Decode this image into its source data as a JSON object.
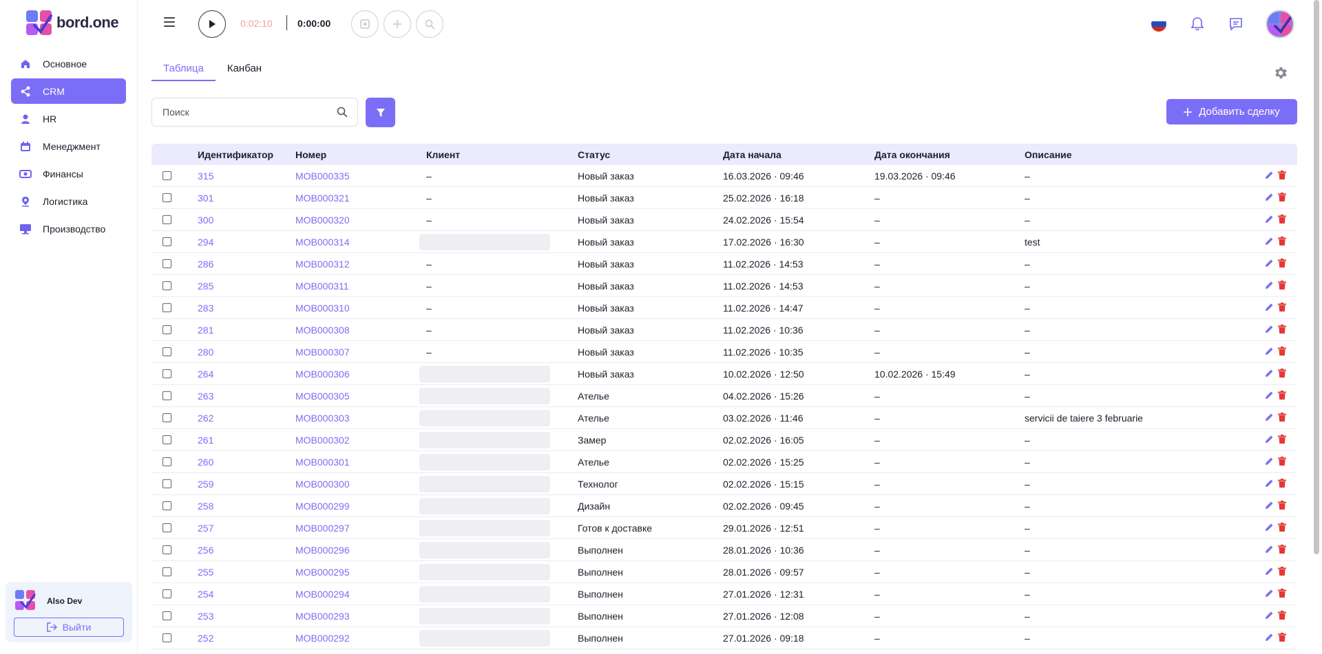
{
  "brand": {
    "name": "bord.one"
  },
  "sidebar": {
    "items": [
      {
        "label": "Основное",
        "icon": "home-icon",
        "active": false
      },
      {
        "label": "CRM",
        "icon": "share-icon",
        "active": true
      },
      {
        "label": "HR",
        "icon": "person-icon",
        "active": false
      },
      {
        "label": "Менеджмент",
        "icon": "calendar-icon",
        "active": false
      },
      {
        "label": "Финансы",
        "icon": "money-icon",
        "active": false
      },
      {
        "label": "Логистика",
        "icon": "location-icon",
        "active": false
      },
      {
        "label": "Производство",
        "icon": "monitor-icon",
        "active": false
      }
    ],
    "user": {
      "name": "Also Dev",
      "logout_label": "Выйти"
    }
  },
  "topbar": {
    "timer_total": "0:02:10",
    "timer_current": "0:00:00"
  },
  "tabs": [
    {
      "label": "Таблица",
      "active": true
    },
    {
      "label": "Канбан",
      "active": false
    }
  ],
  "search": {
    "placeholder": "Поиск"
  },
  "add_button": {
    "label": "Добавить сделку"
  },
  "table": {
    "columns": [
      "Идентификатор",
      "Номер",
      "Клиент",
      "Статус",
      "Дата начала",
      "Дата окончания",
      "Описание"
    ],
    "rows": [
      {
        "id": "315",
        "number": "MOB000335",
        "client": "–",
        "status": "Новый заказ",
        "start": "16.03.2026 · 09:46",
        "end": "19.03.2026 · 09:46",
        "desc": "–"
      },
      {
        "id": "301",
        "number": "MOB000321",
        "client": "–",
        "status": "Новый заказ",
        "start": "25.02.2026 · 16:18",
        "end": "–",
        "desc": "–"
      },
      {
        "id": "300",
        "number": "MOB000320",
        "client": "–",
        "status": "Новый заказ",
        "start": "24.02.2026 · 15:54",
        "end": "–",
        "desc": "–"
      },
      {
        "id": "294",
        "number": "MOB000314",
        "client": null,
        "status": "Новый заказ",
        "start": "17.02.2026 · 16:30",
        "end": "–",
        "desc": "test"
      },
      {
        "id": "286",
        "number": "MOB000312",
        "client": "–",
        "status": "Новый заказ",
        "start": "11.02.2026 · 14:53",
        "end": "–",
        "desc": "–"
      },
      {
        "id": "285",
        "number": "MOB000311",
        "client": "–",
        "status": "Новый заказ",
        "start": "11.02.2026 · 14:53",
        "end": "–",
        "desc": "–"
      },
      {
        "id": "283",
        "number": "MOB000310",
        "client": "–",
        "status": "Новый заказ",
        "start": "11.02.2026 · 14:47",
        "end": "–",
        "desc": "–"
      },
      {
        "id": "281",
        "number": "MOB000308",
        "client": "–",
        "status": "Новый заказ",
        "start": "11.02.2026 · 10:36",
        "end": "–",
        "desc": "–"
      },
      {
        "id": "280",
        "number": "MOB000307",
        "client": "–",
        "status": "Новый заказ",
        "start": "11.02.2026 · 10:35",
        "end": "–",
        "desc": "–"
      },
      {
        "id": "264",
        "number": "MOB000306",
        "client": null,
        "status": "Новый заказ",
        "start": "10.02.2026 · 12:50",
        "end": "10.02.2026 · 15:49",
        "desc": "–"
      },
      {
        "id": "263",
        "number": "MOB000305",
        "client": null,
        "status": "Ателье",
        "start": "04.02.2026 · 15:26",
        "end": "–",
        "desc": "–"
      },
      {
        "id": "262",
        "number": "MOB000303",
        "client": null,
        "status": "Ателье",
        "start": "03.02.2026 · 11:46",
        "end": "–",
        "desc": "servicii de taiere 3 februarie"
      },
      {
        "id": "261",
        "number": "MOB000302",
        "client": null,
        "status": "Замер",
        "start": "02.02.2026 · 16:05",
        "end": "–",
        "desc": "–"
      },
      {
        "id": "260",
        "number": "MOB000301",
        "client": null,
        "status": "Ателье",
        "start": "02.02.2026 · 15:25",
        "end": "–",
        "desc": "–"
      },
      {
        "id": "259",
        "number": "MOB000300",
        "client": null,
        "status": "Технолог",
        "start": "02.02.2026 · 15:15",
        "end": "–",
        "desc": "–"
      },
      {
        "id": "258",
        "number": "MOB000299",
        "client": null,
        "status": "Дизайн",
        "start": "02.02.2026 · 09:45",
        "end": "–",
        "desc": "–"
      },
      {
        "id": "257",
        "number": "MOB000297",
        "client": null,
        "status": "Готов к доставке",
        "start": "29.01.2026 · 12:51",
        "end": "–",
        "desc": "–"
      },
      {
        "id": "256",
        "number": "MOB000296",
        "client": null,
        "status": "Выполнен",
        "start": "28.01.2026 · 10:36",
        "end": "–",
        "desc": "–"
      },
      {
        "id": "255",
        "number": "MOB000295",
        "client": null,
        "status": "Выполнен",
        "start": "28.01.2026 · 09:57",
        "end": "–",
        "desc": "–"
      },
      {
        "id": "254",
        "number": "MOB000294",
        "client": null,
        "status": "Выполнен",
        "start": "27.01.2026 · 12:31",
        "end": "–",
        "desc": "–"
      },
      {
        "id": "253",
        "number": "MOB000293",
        "client": null,
        "status": "Выполнен",
        "start": "27.01.2026 · 12:08",
        "end": "–",
        "desc": "–"
      },
      {
        "id": "252",
        "number": "MOB000292",
        "client": null,
        "status": "Выполнен",
        "start": "27.01.2026 · 09:18",
        "end": "–",
        "desc": "–"
      }
    ]
  },
  "colors": {
    "accent": "#7b6ef6",
    "delete": "#e53935",
    "header_bg": "#ecebfd"
  }
}
